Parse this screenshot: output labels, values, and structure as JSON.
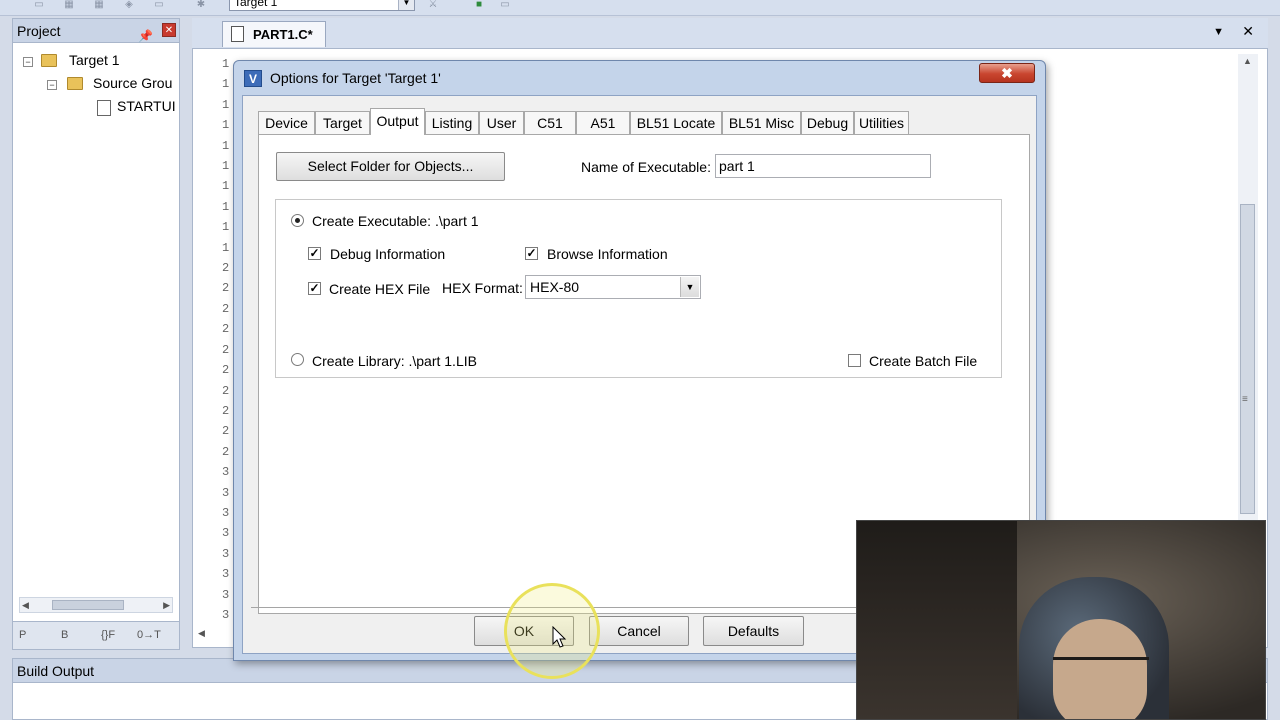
{
  "toolbar": {
    "target_combo": "Target 1"
  },
  "project_panel": {
    "title": "Project",
    "tree": {
      "target": "Target 1",
      "source_group": "Source Grou",
      "startup_file": "STARTUI"
    },
    "tabs": [
      "P",
      "B",
      "{}F",
      "0→T"
    ]
  },
  "editor": {
    "tab_label": "PART1.C*",
    "line_numbers": [
      "1",
      "1",
      "1",
      "1",
      "1",
      "1",
      "1",
      "1",
      "1",
      "1",
      "2",
      "2",
      "2",
      "2",
      "2",
      "2",
      "2",
      "2",
      "2",
      "2",
      "3",
      "3",
      "3",
      "3",
      "3",
      "3",
      "3",
      "3"
    ]
  },
  "build_output": {
    "title": "Build Output"
  },
  "dialog": {
    "title": "Options for Target 'Target 1'",
    "close_symbol": "✖",
    "tabs": [
      {
        "label": "Device"
      },
      {
        "label": "Target"
      },
      {
        "label": "Output"
      },
      {
        "label": "Listing"
      },
      {
        "label": "User"
      },
      {
        "label": "C51"
      },
      {
        "label": "A51"
      },
      {
        "label": "BL51 Locate"
      },
      {
        "label": "BL51 Misc"
      },
      {
        "label": "Debug"
      },
      {
        "label": "Utilities"
      }
    ],
    "active_tab": "Output",
    "output": {
      "select_folder_label": "Select Folder for Objects...",
      "name_of_executable_label": "Name of Executable:",
      "name_of_executable_value": "part 1",
      "create_executable_label": "Create Executable:  .\\part 1",
      "create_executable_selected": true,
      "debug_information_label": "Debug Information",
      "debug_information_checked": true,
      "browse_information_label": "Browse Information",
      "browse_information_checked": true,
      "create_hex_label": "Create HEX File",
      "create_hex_checked": true,
      "hex_format_label": "HEX Format:",
      "hex_format_value": "HEX-80",
      "create_library_label": "Create Library:  .\\part 1.LIB",
      "create_library_selected": false,
      "create_batch_label": "Create Batch File",
      "create_batch_checked": false
    },
    "buttons": {
      "ok": "OK",
      "cancel": "Cancel",
      "defaults": "Defaults"
    }
  }
}
